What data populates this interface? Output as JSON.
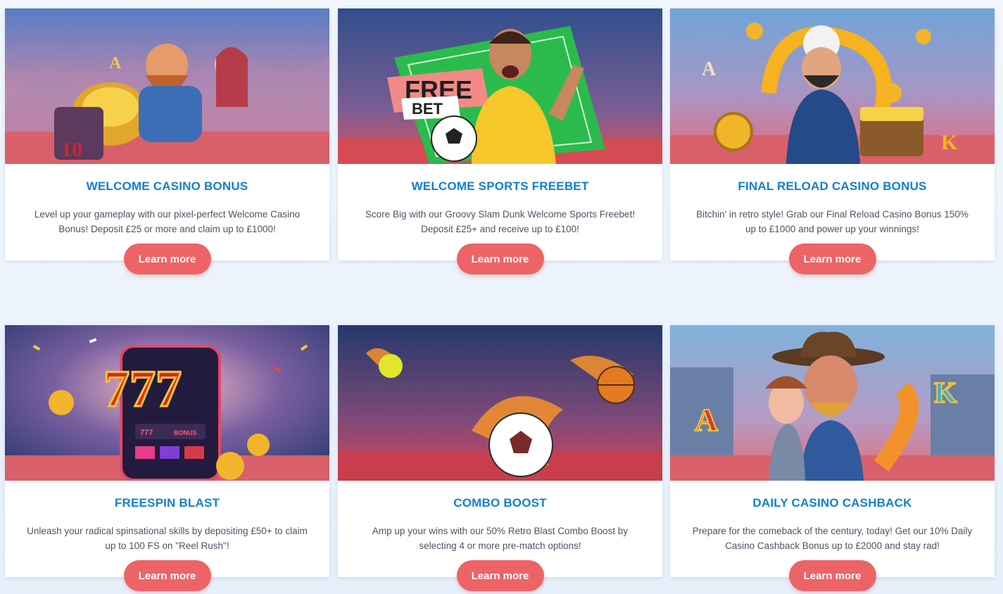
{
  "theme": {
    "title_color": "#1380cc",
    "button_color": "#ec6466",
    "body_text_color": "#4a5564",
    "page_background": "#eef4fb"
  },
  "promotions": [
    {
      "title": "WELCOME CASINO BONUS",
      "description": "Level up your gameplay with our pixel-perfect Welcome Casino Bonus! Deposit £25 or more and claim up to £1000!",
      "button_label": "Learn more"
    },
    {
      "title": "WELCOME SPORTS FREEBET",
      "description": "Score Big with our Groovy Slam Dunk Welcome Sports Freebet! Deposit £25+ and receive up to £100!",
      "button_label": "Learn more",
      "art_text": {
        "line1": "FREE",
        "line2": "BET"
      }
    },
    {
      "title": "FINAL RELOAD CASINO BONUS",
      "description": "Bitchin' in retro style! Grab our Final Reload Casino Bonus 150% up to £1000 and power up your winnings!",
      "button_label": "Learn more"
    },
    {
      "title": "FREESPIN BLAST",
      "description": "Unleash your radical spinsational skills by depositing £50+ to claim up to 100 FS on \"Reel Rush\"!",
      "button_label": "Learn more",
      "art_text": {
        "sevens": "777",
        "reel": "777",
        "bonus": "BONUS"
      }
    },
    {
      "title": "COMBO BOOST",
      "description": "Amp up your wins with our 50% Retro Blast Combo Boost by selecting 4 or more pre-match options!",
      "button_label": "Learn more"
    },
    {
      "title": "DAILY CASINO CASHBACK",
      "description": "Prepare for the comeback of the century, today! Get our 10% Daily Casino Cashback Bonus up to £2000 and stay rad!",
      "button_label": "Learn more"
    }
  ]
}
